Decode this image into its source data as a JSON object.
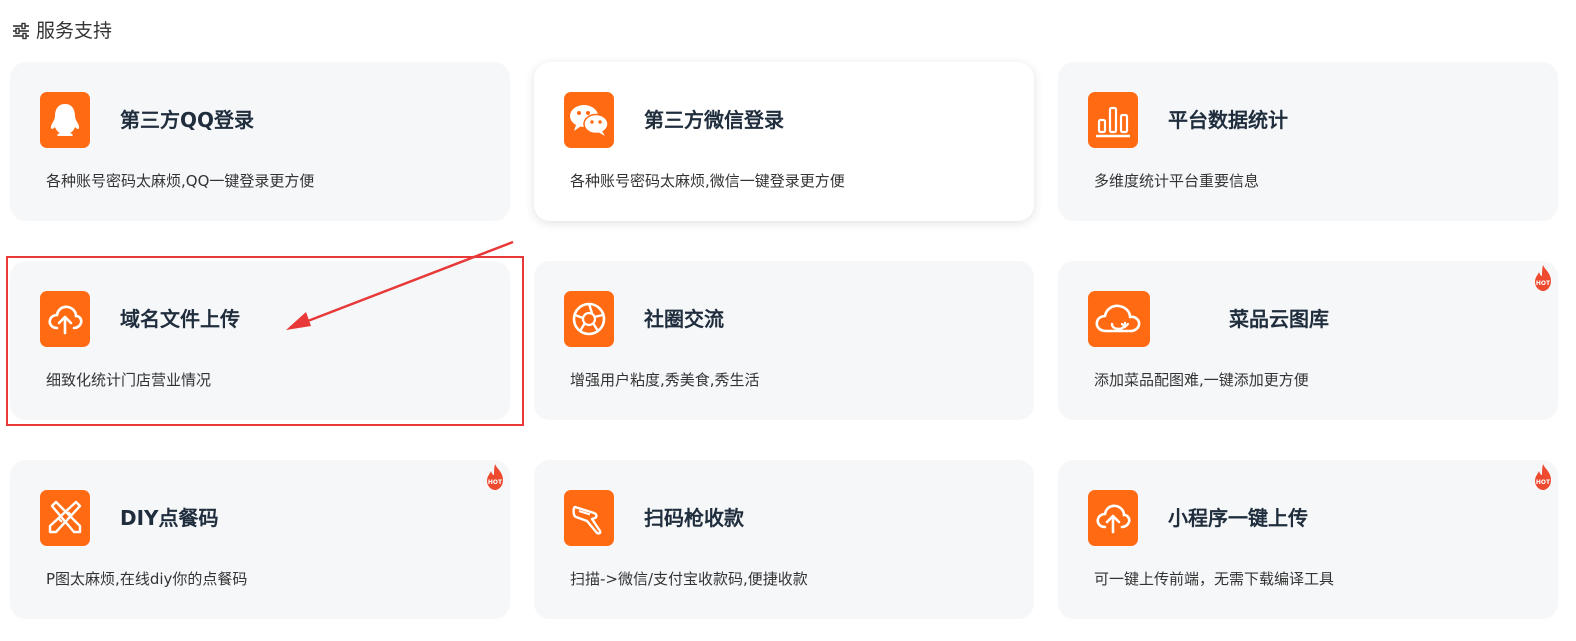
{
  "section": {
    "title": "服务支持",
    "icon": "sliders-icon"
  },
  "accent_color": "#ff6a13",
  "annotation_color": "#e83838",
  "cards": [
    {
      "title": "第三方QQ登录",
      "desc": "各种账号密码太麻烦,QQ一键登录更方便",
      "icon": "qq-icon",
      "hot": false,
      "active": false
    },
    {
      "title": "第三方微信登录",
      "desc": "各种账号密码太麻烦,微信一键登录更方便",
      "icon": "wechat-icon",
      "hot": false,
      "active": true
    },
    {
      "title": "平台数据统计",
      "desc": "多维度统计平台重要信息",
      "icon": "bar-chart-icon",
      "hot": false,
      "active": false
    },
    {
      "title": "域名文件上传",
      "desc": "细致化统计门店营业情况",
      "icon": "cloud-upload-icon",
      "hot": false,
      "active": false
    },
    {
      "title": "社圈交流",
      "desc": "增强用户粘度,秀美食,秀生活",
      "icon": "aperture-icon",
      "hot": false,
      "active": false
    },
    {
      "title": "菜品云图库",
      "desc": "添加菜品配图难,一键添加更方便",
      "icon": "cloud-download-icon",
      "hot": true,
      "active": false
    },
    {
      "title": "DIY点餐码",
      "desc": "P图太麻烦,在线diy你的点餐码",
      "icon": "pencil-ruler-icon",
      "hot": true,
      "active": false
    },
    {
      "title": "扫码枪收款",
      "desc": "扫描->微信/支付宝收款码,便捷收款",
      "icon": "scanner-gun-icon",
      "hot": false,
      "active": false
    },
    {
      "title": "小程序一键上传",
      "desc": "可一键上传前端，无需下载编译工具",
      "icon": "cloud-upload-icon",
      "hot": true,
      "active": false
    }
  ],
  "hot_badge": {
    "label": "HOT",
    "color": "#ee4a2f"
  }
}
